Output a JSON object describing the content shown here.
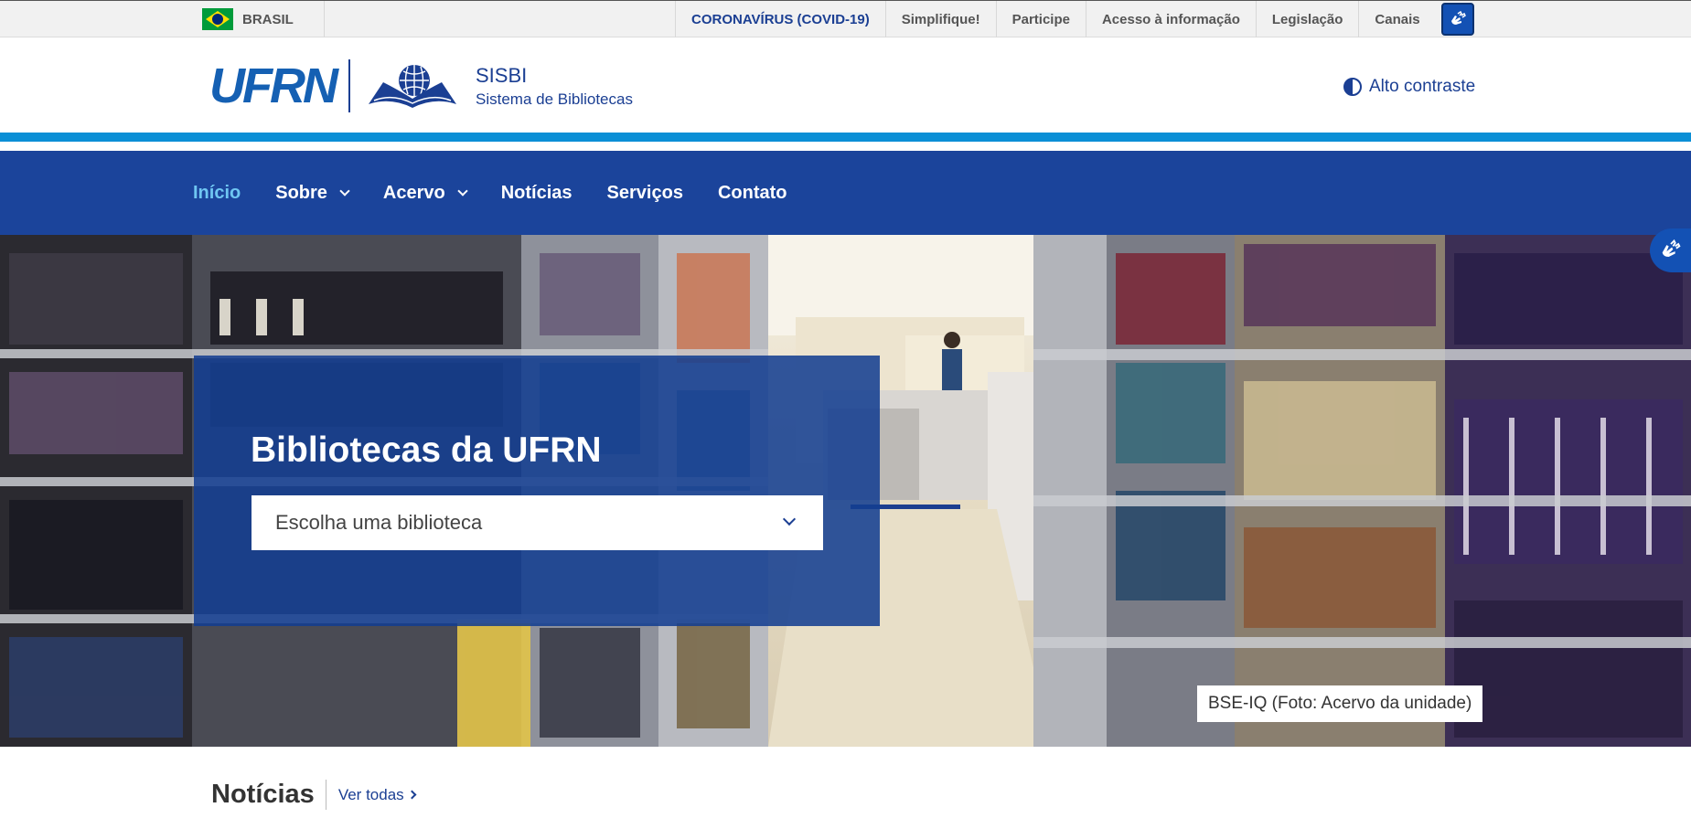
{
  "gov_bar": {
    "country": "BRASIL",
    "links": [
      "CORONAVÍRUS (COVID-19)",
      "Simplifique!",
      "Participe",
      "Acesso à informação",
      "Legislação",
      "Canais"
    ]
  },
  "header": {
    "logo_text": "UFRN",
    "title": "SISBI",
    "subtitle": "Sistema de Bibliotecas",
    "contrast_label": "Alto contraste"
  },
  "nav": {
    "items": [
      {
        "label": "Início",
        "active": true
      },
      {
        "label": "Sobre",
        "dropdown": true
      },
      {
        "label": "Acervo",
        "dropdown": true
      },
      {
        "label": "Notícias"
      },
      {
        "label": "Serviços"
      },
      {
        "label": "Contato"
      }
    ]
  },
  "hero": {
    "title": "Bibliotecas da UFRN",
    "select_placeholder": "Escolha uma biblioteca",
    "caption": "BSE-IQ (Foto: Acervo da unidade)"
  },
  "news": {
    "title": "Notícias",
    "see_all": "Ver todas"
  },
  "colors": {
    "nav_bg": "#1b449b",
    "accent_stripe": "#0b8fd6",
    "active_nav": "#6fc6f2",
    "brand_blue": "#1b3f93"
  },
  "icons": [
    "brazil-flag-icon",
    "vlibras-hands-icon",
    "contrast-icon",
    "chevron-down-icon",
    "chevron-right-icon"
  ]
}
